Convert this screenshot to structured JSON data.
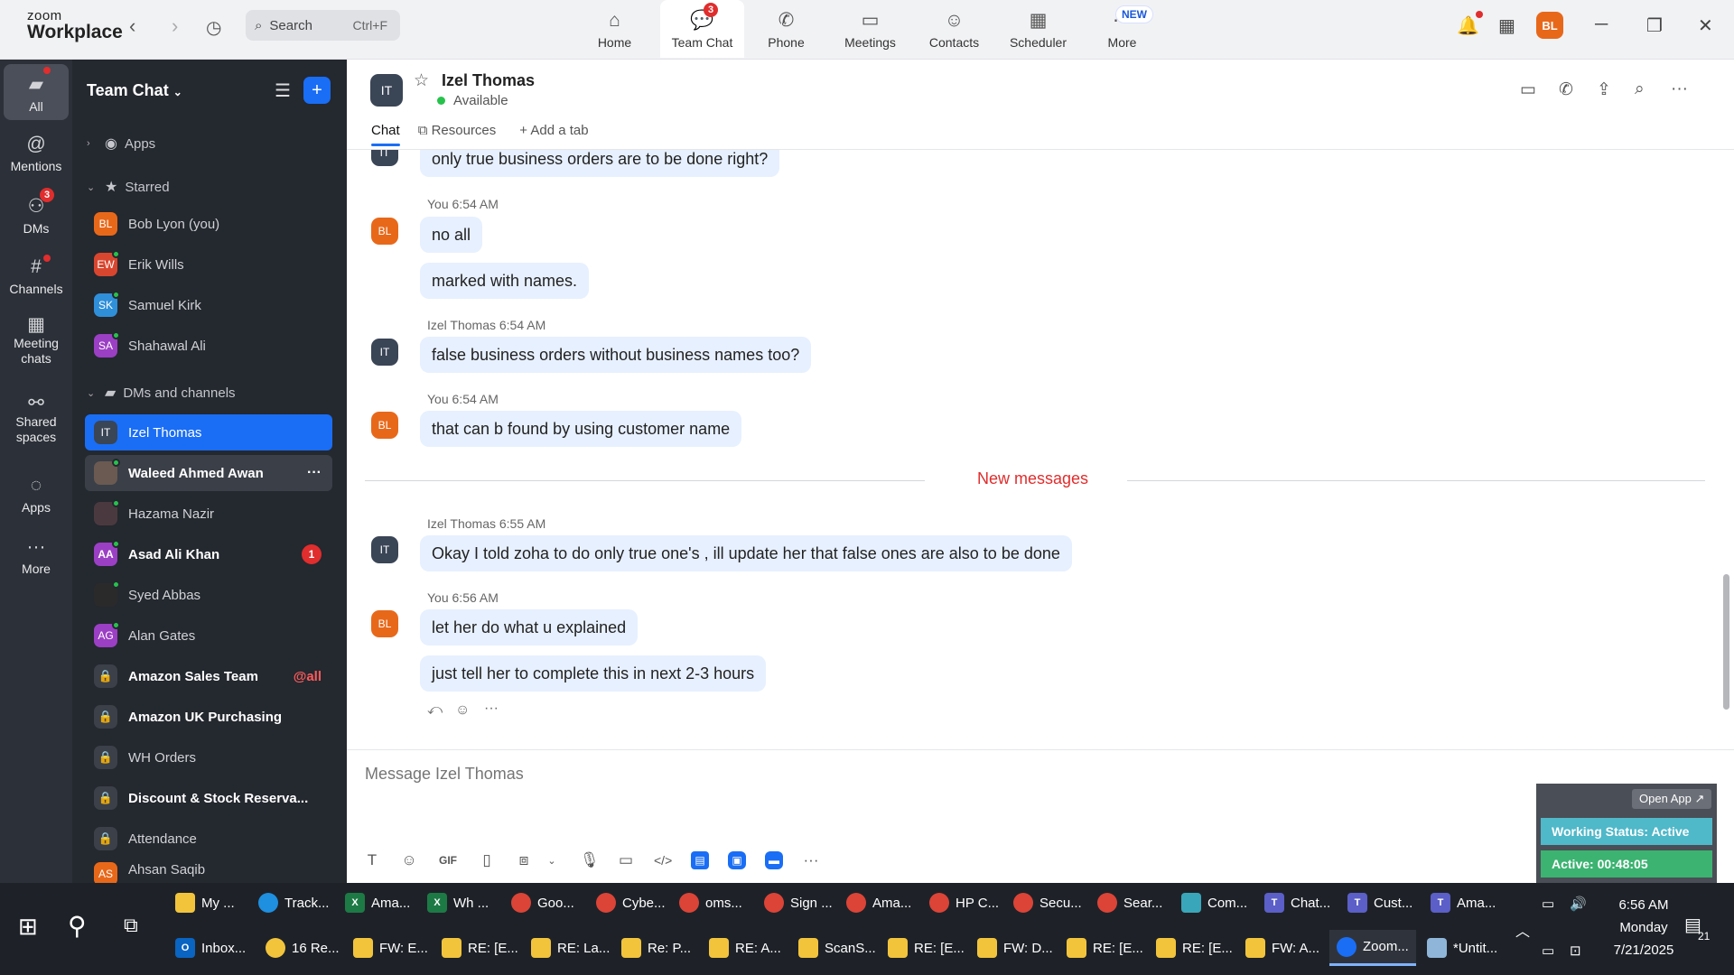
{
  "app": {
    "brand_top": "zoom",
    "brand_bottom": "Workplace"
  },
  "search": {
    "placeholder": "Search",
    "shortcut": "Ctrl+F"
  },
  "top_tabs": [
    {
      "label": "Home",
      "icon": "home-icon"
    },
    {
      "label": "Team Chat",
      "icon": "chat-icon",
      "badge": "3"
    },
    {
      "label": "Phone",
      "icon": "phone-icon"
    },
    {
      "label": "Meetings",
      "icon": "video-icon"
    },
    {
      "label": "Contacts",
      "icon": "contacts-icon"
    },
    {
      "label": "Scheduler",
      "icon": "calendar-icon"
    },
    {
      "label": "More",
      "icon": "more-icon",
      "tag": "NEW"
    }
  ],
  "user": {
    "initials": "BL"
  },
  "rail": [
    {
      "label": "All"
    },
    {
      "label": "Mentions"
    },
    {
      "label": "DMs",
      "badge": "3"
    },
    {
      "label": "Channels"
    },
    {
      "label": "Meeting chats"
    },
    {
      "label": "Shared spaces"
    },
    {
      "label": "Apps"
    },
    {
      "label": "More"
    }
  ],
  "sidebar": {
    "title": "Team Chat",
    "sections": {
      "apps": "Apps",
      "starred": "Starred",
      "dms": "DMs and channels"
    },
    "starred": [
      {
        "initials": "BL",
        "name": "Bob Lyon (you)",
        "color": "#e8681a"
      },
      {
        "initials": "EW",
        "name": "Erik Wills",
        "color": "#d9462f"
      },
      {
        "initials": "SK",
        "name": "Samuel Kirk",
        "color": "#2f8fd9"
      },
      {
        "initials": "SA",
        "name": "Shahawal Ali",
        "color": "#9b3fc4"
      }
    ],
    "dms": [
      {
        "initials": "IT",
        "name": "Izel Thomas",
        "color": "#3a4556"
      },
      {
        "initials": "",
        "name": "Waleed Ahmed Awan",
        "color": "#6b5a52"
      },
      {
        "initials": "",
        "name": "Hazama Nazir",
        "color": "#4a3a3f"
      },
      {
        "initials": "AA",
        "name": "Asad Ali Khan",
        "color": "#9b3fc4",
        "count": "1"
      },
      {
        "initials": "",
        "name": "Syed Abbas",
        "color": "#2a2a2a"
      },
      {
        "initials": "AG",
        "name": "Alan Gates",
        "color": "#9b3fc4"
      },
      {
        "initials": "",
        "name": "Amazon Sales Team",
        "mention": "@all"
      },
      {
        "initials": "",
        "name": "Amazon UK Purchasing"
      },
      {
        "initials": "",
        "name": "WH Orders"
      },
      {
        "initials": "",
        "name": "Discount & Stock Reserva..."
      },
      {
        "initials": "",
        "name": "Attendance"
      },
      {
        "initials": "AS",
        "name": "Ahsan Saqib",
        "color": "#e8681a"
      }
    ]
  },
  "chat": {
    "contact": "Izel Thomas",
    "contact_initials": "IT",
    "status": "Available",
    "tabs": {
      "chat": "Chat",
      "resources": "Resources",
      "add": "Add a tab"
    },
    "messages": [
      {
        "meta": "",
        "text": "only true business orders are to be done right?"
      },
      {
        "meta": "You 6:54 AM",
        "text": "no all"
      },
      {
        "meta": "",
        "text": "marked with names."
      },
      {
        "meta": "Izel Thomas 6:54 AM",
        "text": "false business orders without business names too?"
      },
      {
        "meta": "You 6:54 AM",
        "text": "that can b found by using customer name"
      },
      {
        "meta": "Izel Thomas 6:55 AM",
        "text": "Okay I told zoha to do only true one's , ill update her that false ones are also to be done"
      },
      {
        "meta": "You 6:56 AM",
        "text": "let her do what u explained"
      },
      {
        "meta": "",
        "text": "just tell her to complete this in next 2-3 hours"
      }
    ],
    "new_messages_label": "New messages",
    "composer_placeholder": "Message Izel Thomas",
    "gif_label": "GIF"
  },
  "widget": {
    "open_app": "Open App ↗",
    "working_status": "Working Status: Active",
    "active_timer": "Active: 00:48:05"
  },
  "taskbar": {
    "row1": [
      "My ...",
      "Track...",
      "Ama...",
      "Wh ...",
      "Goo...",
      "Cybe...",
      "oms...",
      "Sign ...",
      "Ama...",
      "HP C...",
      "Secu...",
      "Sear...",
      "Com...",
      "Chat...",
      "Cust...",
      "Ama..."
    ],
    "row2": [
      "Inbox...",
      "16 Re...",
      "FW: E...",
      "RE: [E...",
      "RE: La...",
      "Re: P...",
      "RE: A...",
      "ScanS...",
      "RE: [E...",
      "FW: D...",
      "RE: [E...",
      "RE: [E...",
      "FW: A...",
      "Zoom...",
      "*Untit..."
    ],
    "time": "6:56 AM",
    "day": "Monday",
    "date": "7/21/2025",
    "notif_count": "21"
  }
}
